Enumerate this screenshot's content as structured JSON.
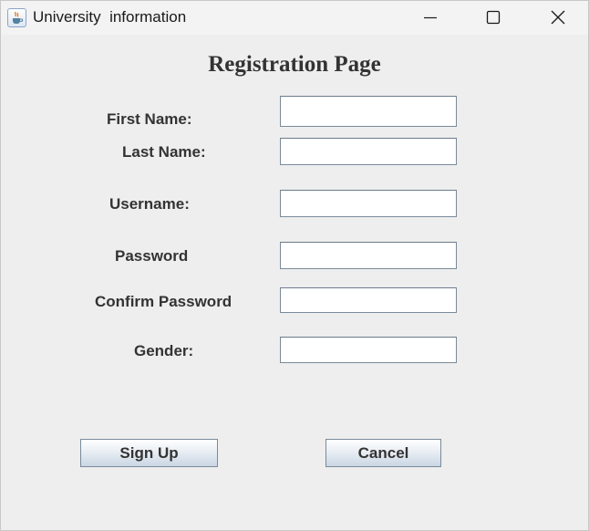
{
  "window": {
    "title": "University  information",
    "app_icon": "java-coffee-icon",
    "controls": [
      "minimize-icon",
      "maximize-icon",
      "close-icon"
    ]
  },
  "form": {
    "heading": "Registration Page",
    "fields": {
      "first_name": {
        "label": "First Name:",
        "value": ""
      },
      "last_name": {
        "label": "Last Name:",
        "value": ""
      },
      "username": {
        "label": "Username:",
        "value": ""
      },
      "password": {
        "label": "Password",
        "value": ""
      },
      "confirm_password": {
        "label": "Confirm Password",
        "value": ""
      },
      "gender": {
        "label": "Gender:",
        "value": ""
      }
    },
    "buttons": {
      "sign_up": "Sign Up",
      "cancel": "Cancel"
    }
  },
  "colors": {
    "background": "#eeeeee",
    "titlebar": "#f3f3f3",
    "text": "#333333",
    "field_border": "#7a8a99",
    "button_gradient_bottom": "#cad6e4"
  }
}
